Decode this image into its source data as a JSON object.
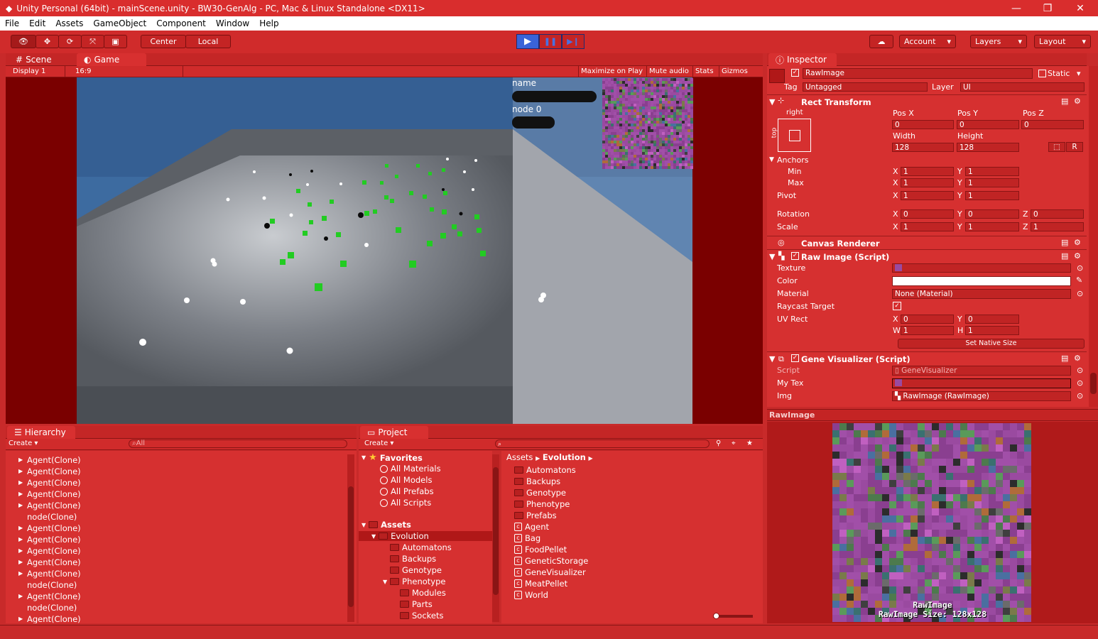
{
  "window": {
    "title": "Unity Personal (64bit) - mainScene.unity - BW30-GenAlg - PC, Mac & Linux Standalone <DX11>",
    "minimize": "—",
    "restore": "❐",
    "close": "✕"
  },
  "menu": [
    "File",
    "Edit",
    "Assets",
    "GameObject",
    "Component",
    "Window",
    "Help"
  ],
  "toolbar": {
    "center": "Center",
    "local": "Local",
    "account": "Account",
    "layers": "Layers",
    "layout": "Layout"
  },
  "scene_tab": "Scene",
  "game_tab": "Game",
  "game_bar": {
    "display": "Display 1",
    "aspect": "16:9",
    "maximize": "Maximize on Play",
    "mute": "Mute audio",
    "stats": "Stats",
    "gizmos": "Gizmos"
  },
  "overlay": {
    "name": "name",
    "node": "node 0"
  },
  "hierarchy": {
    "tab": "Hierarchy",
    "create": "Create",
    "search_placeholder": "All",
    "rows": [
      "Agent(Clone)",
      "Agent(Clone)",
      "Agent(Clone)",
      "Agent(Clone)",
      "Agent(Clone)",
      "node(Clone)",
      "Agent(Clone)",
      "Agent(Clone)",
      "Agent(Clone)",
      "Agent(Clone)",
      "Agent(Clone)",
      "node(Clone)",
      "Agent(Clone)",
      "node(Clone)",
      "Agent(Clone)"
    ]
  },
  "project": {
    "tab": "Project",
    "create": "Create",
    "favorites": "Favorites",
    "fav_items": [
      "All Materials",
      "All Models",
      "All Prefabs",
      "All Scripts"
    ],
    "assets": "Assets",
    "evolution": "Evolution",
    "tree": [
      "Automatons",
      "Backups",
      "Genotype",
      "Phenotype",
      "Modules",
      "Parts",
      "Sockets"
    ],
    "breadcrumb": [
      "Assets",
      "Evolution"
    ],
    "folders": [
      "Automatons",
      "Backups",
      "Genotype",
      "Phenotype",
      "Prefabs"
    ],
    "scripts": [
      "Agent",
      "Bag",
      "FoodPellet",
      "GeneticStorage",
      "GeneVisualizer",
      "MeatPellet",
      "World"
    ]
  },
  "inspector": {
    "tab": "Inspector",
    "name": "RawImage",
    "static": "Static",
    "tag_label": "Tag",
    "tag": "Untagged",
    "layer_label": "Layer",
    "layer": "UI",
    "rect": {
      "title": "Rect Transform",
      "anchor_preset": "right",
      "side_label": "top",
      "posx_l": "Pos X",
      "posy_l": "Pos Y",
      "posz_l": "Pos Z",
      "posx": "0",
      "posy": "0",
      "posz": "0",
      "width_l": "Width",
      "height_l": "Height",
      "width": "128",
      "height": "128",
      "r_btn": "R",
      "anchors": "Anchors",
      "min": "Min",
      "max": "Max",
      "pivot": "Pivot",
      "rotation": "Rotation",
      "scale": "Scale",
      "x": "X",
      "y": "Y",
      "z": "Z",
      "min_x": "1",
      "min_y": "1",
      "max_x": "1",
      "max_y": "1",
      "pivot_x": "1",
      "pivot_y": "1",
      "rot_x": "0",
      "rot_y": "0",
      "rot_z": "0",
      "scale_x": "1",
      "scale_y": "1",
      "scale_z": "1"
    },
    "canvas_renderer": "Canvas Renderer",
    "raw_image": {
      "title": "Raw Image (Script)",
      "texture": "Texture",
      "color": "Color",
      "material": "Material",
      "material_value": "None (Material)",
      "raycast": "Raycast Target",
      "uvrect": "UV Rect",
      "uv_x": "0",
      "uv_y": "0",
      "uv_w": "1",
      "uv_h": "1",
      "w": "W",
      "h": "H",
      "native": "Set Native Size"
    },
    "gene": {
      "title": "Gene Visualizer (Script)",
      "script": "Script",
      "script_value": "GeneVisualizer",
      "mytex": "My Tex",
      "img": "Img",
      "img_value": "RawImage (RawImage)"
    }
  },
  "preview": {
    "header": "RawImage",
    "caption": "RawImage",
    "size": "RawImage Size: 128x128"
  },
  "colors": {
    "accent": "#d63030",
    "dark": "#8a1515",
    "play": "#3a63d8"
  }
}
